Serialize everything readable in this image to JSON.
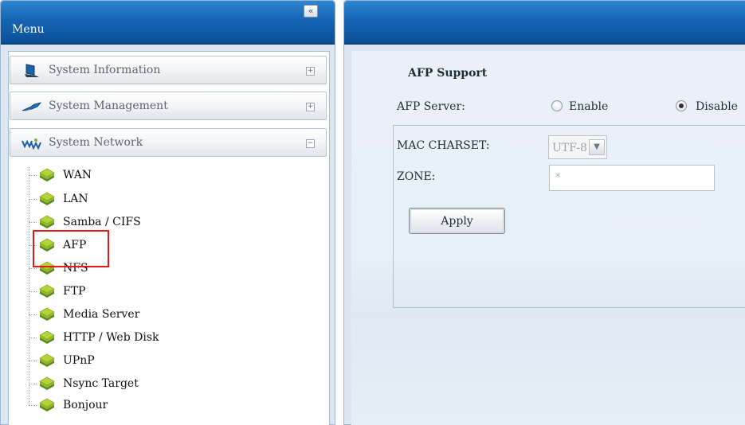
{
  "menu": {
    "title": "Menu",
    "collapse_icon": "double-chevron-left-icon",
    "collapse_label": "«",
    "categories": [
      {
        "label": "System Information",
        "icon": "monitor-icon",
        "toggle": "+"
      },
      {
        "label": "System Management",
        "icon": "wrench-icon",
        "toggle": "+"
      },
      {
        "label": "System Network",
        "icon": "network-icon",
        "toggle": "−"
      }
    ],
    "network_items": [
      {
        "label": "WAN"
      },
      {
        "label": "LAN"
      },
      {
        "label": "Samba / CIFS"
      },
      {
        "label": "AFP"
      },
      {
        "label": "NFS"
      },
      {
        "label": "FTP"
      },
      {
        "label": "Media Server"
      },
      {
        "label": "HTTP / Web Disk"
      },
      {
        "label": "UPnP"
      },
      {
        "label": "Nsync Target"
      },
      {
        "label": "Bonjour"
      }
    ],
    "highlighted_item": "AFP",
    "highlight_color": "#e31818"
  },
  "afp": {
    "legend": "AFP Support",
    "server_label": "AFP Server:",
    "enable_label": "Enable",
    "disable_label": "Disable",
    "server_value": "Disable",
    "charset_label": "MAC CHARSET:",
    "charset_value": "UTF-8",
    "zone_label": "ZONE:",
    "zone_value": "*",
    "apply_label": "Apply"
  },
  "colors": {
    "header_blue": "#1565b4",
    "panel_bg": "#dce7f2",
    "content_bg": "#eaf1f8"
  }
}
